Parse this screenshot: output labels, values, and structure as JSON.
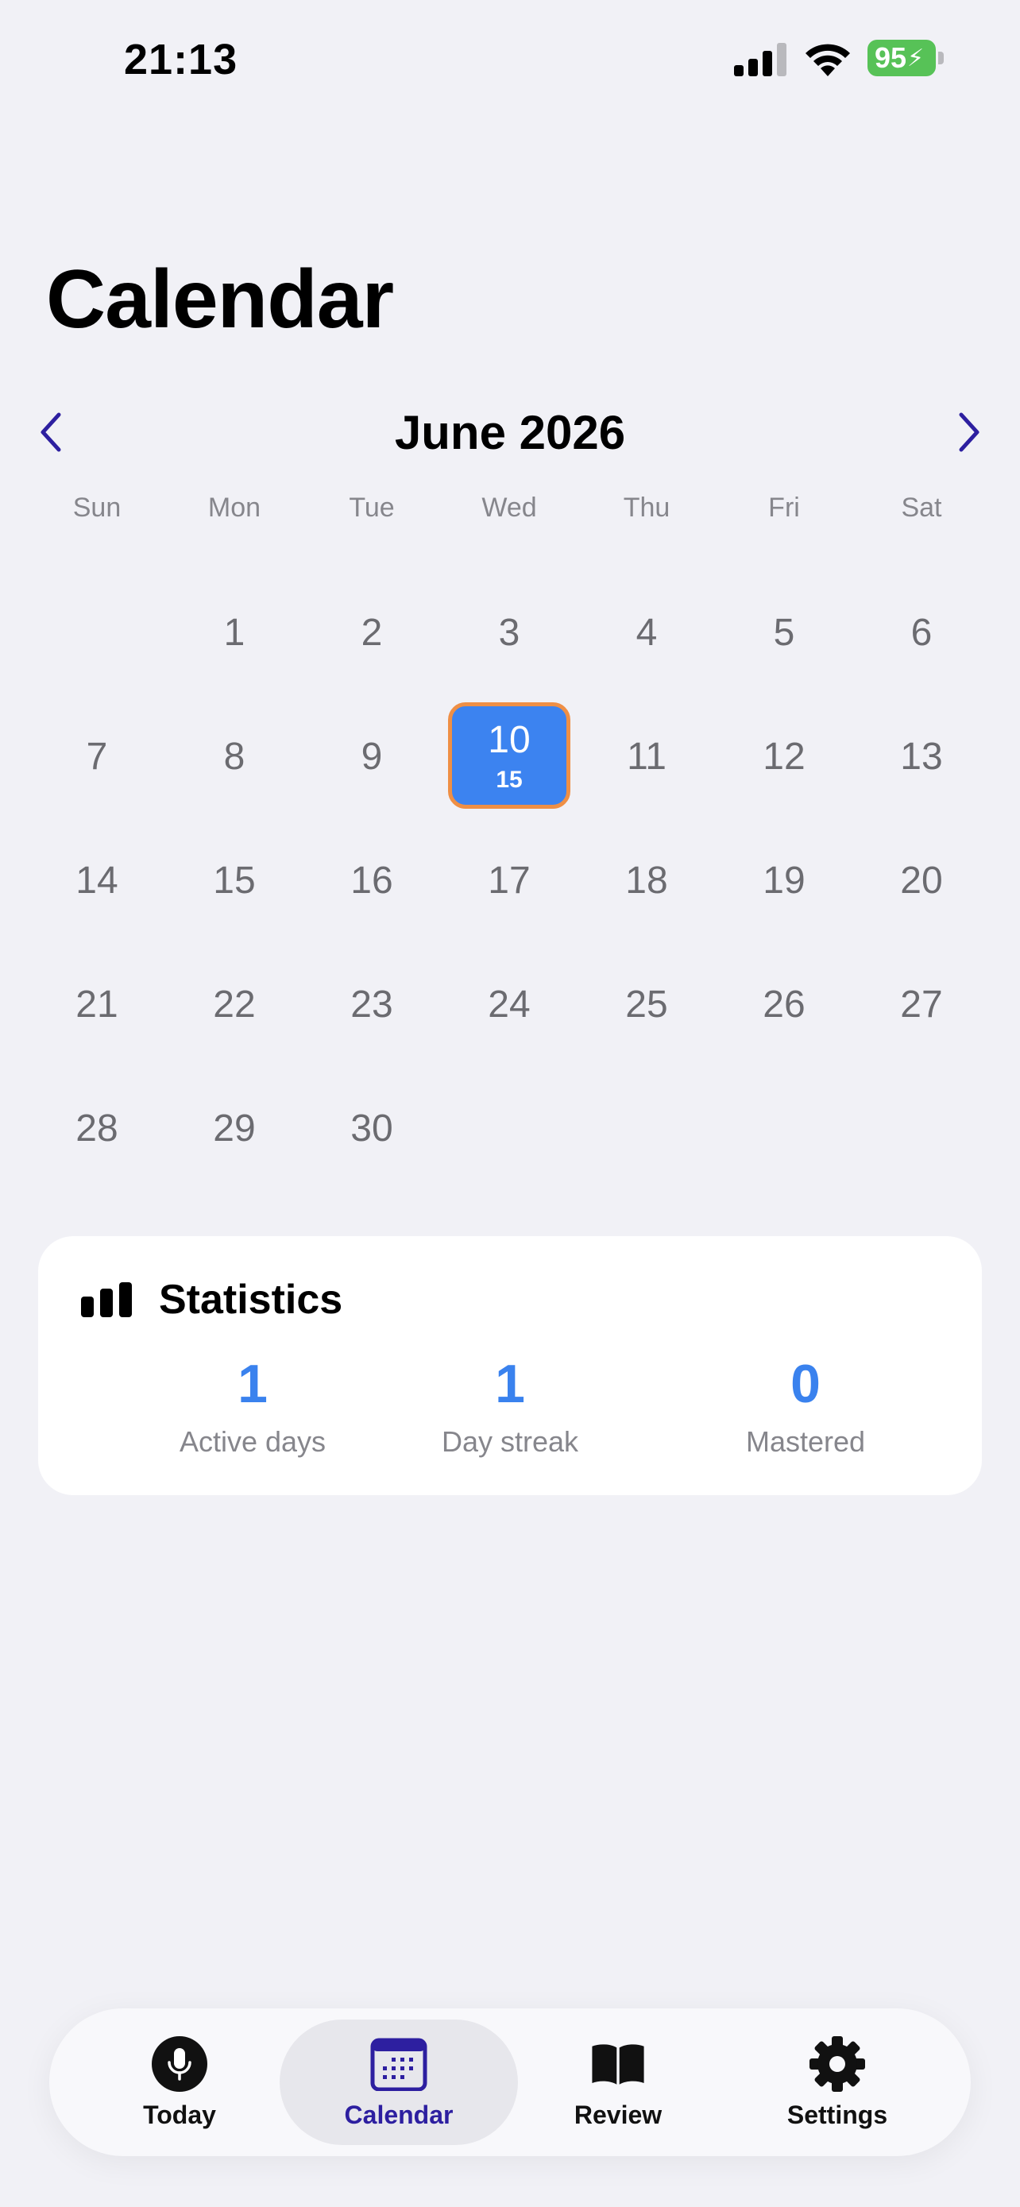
{
  "status_bar": {
    "time": "21:13",
    "battery_percent": "95",
    "battery_color": "#57c257",
    "icons": [
      "signal-icon",
      "wifi-icon",
      "battery-icon"
    ]
  },
  "page": {
    "title": "Calendar"
  },
  "calendar": {
    "month_label": "June 2026",
    "prev_icon": "chevron-left-icon",
    "next_icon": "chevron-right-icon",
    "weekdays": [
      "Sun",
      "Mon",
      "Tue",
      "Wed",
      "Thu",
      "Fri",
      "Sat"
    ],
    "weeks": [
      [
        "",
        "1",
        "2",
        "3",
        "4",
        "5",
        "6"
      ],
      [
        "7",
        "8",
        "9",
        "10",
        "11",
        "12",
        "13"
      ],
      [
        "14",
        "15",
        "16",
        "17",
        "18",
        "19",
        "20"
      ],
      [
        "21",
        "22",
        "23",
        "24",
        "25",
        "26",
        "27"
      ],
      [
        "28",
        "29",
        "30",
        "",
        "",
        "",
        ""
      ]
    ],
    "selected_day": {
      "day": "10",
      "count": "15",
      "fill_color": "#3c83f0",
      "border_color": "#ef8f45"
    }
  },
  "statistics": {
    "icon": "bar-chart-icon",
    "title": "Statistics",
    "items": [
      {
        "value": "1",
        "label": "Active days"
      },
      {
        "value": "1",
        "label": "Day streak"
      },
      {
        "value": "0",
        "label": "Mastered"
      }
    ],
    "accent_color": "#3a82ee"
  },
  "tab_bar": {
    "tabs": [
      {
        "label": "Today",
        "icon": "microphone-icon",
        "active": false
      },
      {
        "label": "Calendar",
        "icon": "calendar-icon",
        "active": true
      },
      {
        "label": "Review",
        "icon": "book-icon",
        "active": false
      },
      {
        "label": "Settings",
        "icon": "gear-icon",
        "active": false
      }
    ],
    "active_color": "#2d1fa0"
  }
}
